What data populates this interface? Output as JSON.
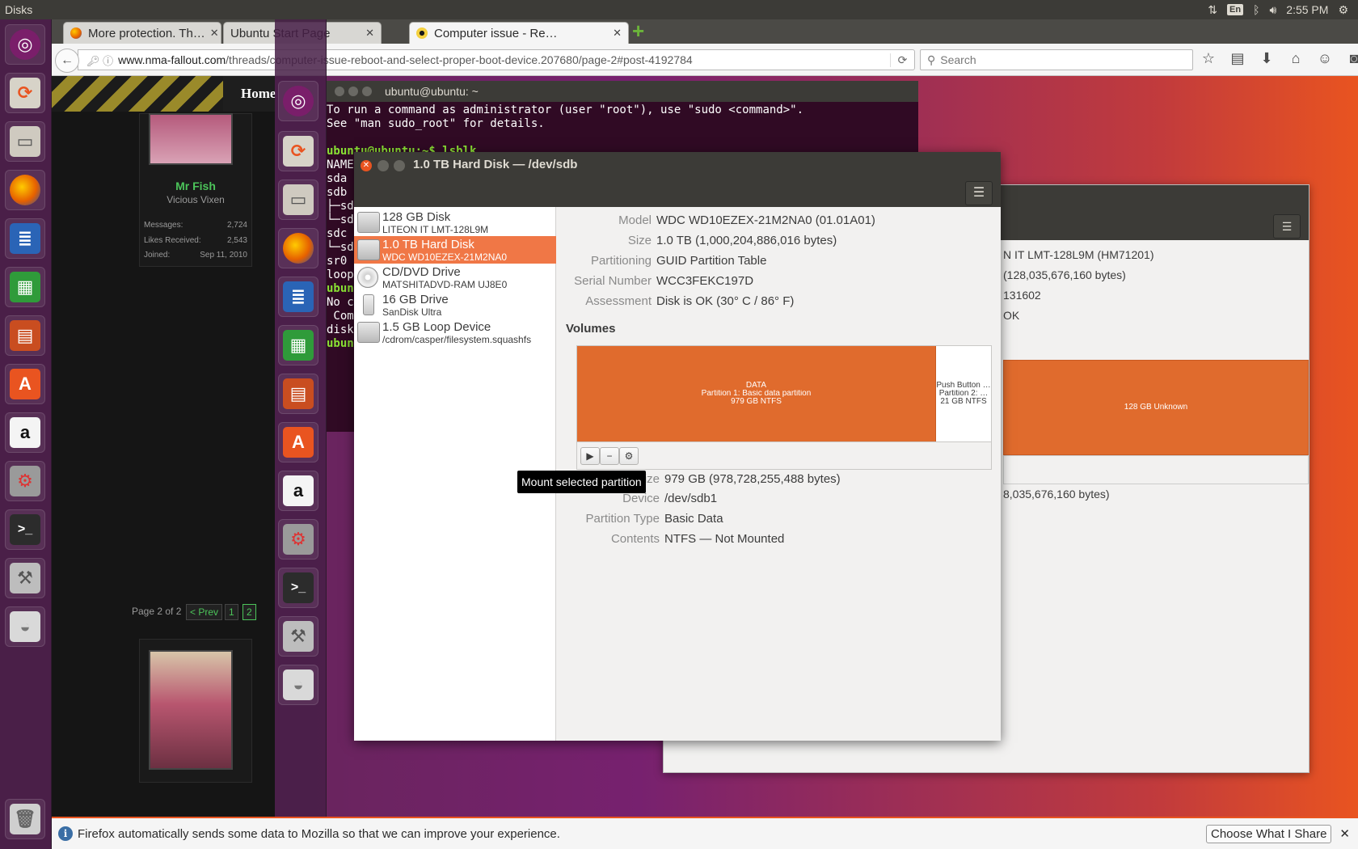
{
  "top_panel": {
    "app_name": "Disks",
    "keyboard": "En",
    "clock": "2:55 PM"
  },
  "firefox": {
    "tabs": [
      {
        "label": "More protection. Th…",
        "active": false
      },
      {
        "label": "Ubuntu Start Page",
        "active": false
      },
      {
        "label": "Computer issue - Re…",
        "active": true
      }
    ],
    "url_host": "www.nma-fallout.com",
    "url_path": "/threads/computer-issue-reboot-and-select-proper-boot-device.207680/page-2#post-4192784",
    "search_placeholder": "Search",
    "notification": {
      "text": "Firefox automatically sends some data to Mozilla so that we can improve your experience.",
      "button": "Choose What I Share"
    }
  },
  "forum": {
    "home": "Home",
    "poster_name": "Mr Fish",
    "poster_title": "Vicious Vixen",
    "stats": [
      {
        "label": "Messages:",
        "value": "2,724"
      },
      {
        "label": "Likes Received:",
        "value": "2,543"
      },
      {
        "label": "Joined:",
        "value": "Sep 11, 2010"
      }
    ],
    "pager": {
      "text": "Page 2 of 2",
      "prev": "< Prev",
      "p1": "1",
      "p2": "2"
    }
  },
  "terminal": {
    "title": "ubuntu@ubuntu: ~",
    "lines": [
      "To run a command as administrator (user \"root\"), use \"sudo <command>\".",
      "See \"man sudo_root\" for details.",
      "",
      "ubuntu@ubuntu:~$ lsblk",
      "NAME",
      "sda",
      "sdb",
      "├─sd",
      "└─sd",
      "sdc",
      "└─sd",
      "sr0",
      "loop",
      "ubun",
      "No c",
      " Com",
      "disk",
      "ubun"
    ]
  },
  "disks_bg": {
    "lines": [
      "N IT LMT-128L9M (HM71201)",
      "(128,035,676,160 bytes)",
      "131602",
      "OK"
    ],
    "volume_label": "128 GB Unknown",
    "size_line": "8,035,676,160 bytes)"
  },
  "disks": {
    "title": "1.0 TB Hard Disk — /dev/sdb",
    "devices": [
      {
        "name": "128 GB Disk",
        "sub": "LITEON IT LMT-128L9M",
        "kind": "hdd"
      },
      {
        "name": "1.0 TB Hard Disk",
        "sub": "WDC WD10EZEX-21M2NA0",
        "kind": "hdd"
      },
      {
        "name": "CD/DVD Drive",
        "sub": "MATSHITADVD-RAM UJ8E0",
        "kind": "optical"
      },
      {
        "name": "16 GB Drive",
        "sub": "SanDisk Ultra",
        "kind": "usb"
      },
      {
        "name": "1.5 GB Loop Device",
        "sub": "/cdrom/casper/filesystem.squashfs",
        "kind": "hdd"
      }
    ],
    "selected_device": 1,
    "details": [
      {
        "key": "Model",
        "value": "WDC WD10EZEX-21M2NA0 (01.01A01)"
      },
      {
        "key": "Size",
        "value": "1.0 TB (1,000,204,886,016 bytes)"
      },
      {
        "key": "Partitioning",
        "value": "GUID Partition Table"
      },
      {
        "key": "Serial Number",
        "value": "WCC3FEKC197D"
      },
      {
        "key": "Assessment",
        "value": "Disk is OK (30° C / 86° F)"
      }
    ],
    "volumes_heading": "Volumes",
    "partitions": [
      {
        "l1": "DATA",
        "l2": "Partition 1: Basic data partition",
        "l3": "979 GB NTFS"
      },
      {
        "l1": "Push Button …",
        "l2": "Partition 2: …",
        "l3": "21 GB NTFS"
      }
    ],
    "tooltip": "Mount selected partition",
    "partition_details": [
      {
        "key": "Size",
        "value": "979 GB (978,728,255,488 bytes)"
      },
      {
        "key": "Device",
        "value": "/dev/sdb1"
      },
      {
        "key": "Partition Type",
        "value": "Basic Data"
      },
      {
        "key": "Contents",
        "value": "NTFS — Not Mounted"
      }
    ]
  }
}
